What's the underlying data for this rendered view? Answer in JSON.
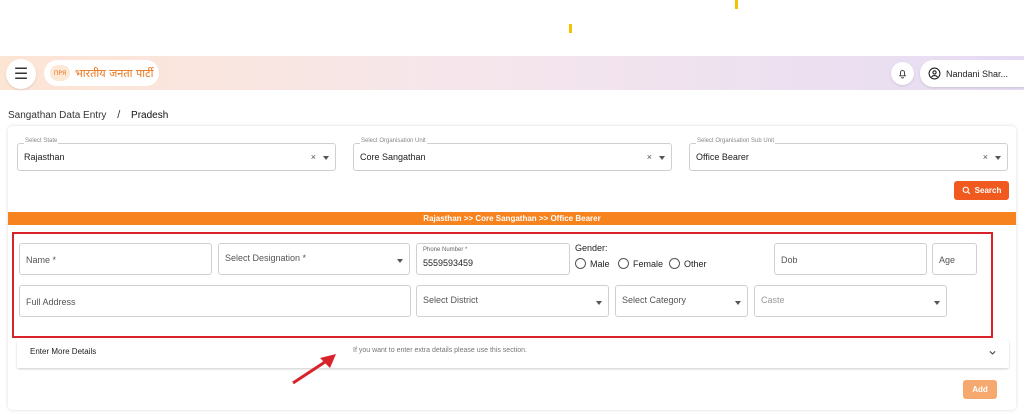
{
  "header": {
    "logo_mark": "ПРЯ",
    "logo_text": "भारतीय जनता पार्टी",
    "user_name": "Nandani Shar..."
  },
  "breadcrumb": {
    "parent": "Sangathan Data Entry",
    "separator": "/",
    "current": "Pradesh"
  },
  "filters": {
    "state": {
      "label": "Select State",
      "value": "Rajasthan"
    },
    "org_unit": {
      "label": "Select Organisation Unit",
      "value": "Core Sangathan"
    },
    "org_sub_unit": {
      "label": "Select Organisation Sub Unit",
      "value": "Office Bearer"
    },
    "clear_glyph": "×",
    "search_label": "Search"
  },
  "path_banner": "Rajasthan >> Core Sangathan >> Office Bearer",
  "form": {
    "name_placeholder": "Name *",
    "designation_placeholder": "Select Designation *",
    "phone_label": "Phone Number *",
    "phone_value": "5559593459",
    "gender_label": "Gender:",
    "gender_options": [
      "Male",
      "Female",
      "Other"
    ],
    "dob_placeholder": "Dob",
    "age_placeholder": "Age",
    "address_placeholder": "Full Address",
    "district_placeholder": "Select District",
    "category_placeholder": "Select Category",
    "caste_placeholder": "Caste"
  },
  "more_details": {
    "title": "Enter More Details",
    "hint": "If you want to enter extra details please use this section."
  },
  "actions": {
    "add_label": "Add"
  },
  "colors": {
    "accent": "#f05a1f",
    "banner": "#f7831f",
    "highlight_frame": "#d8232a",
    "brand_text": "#e8731a"
  }
}
